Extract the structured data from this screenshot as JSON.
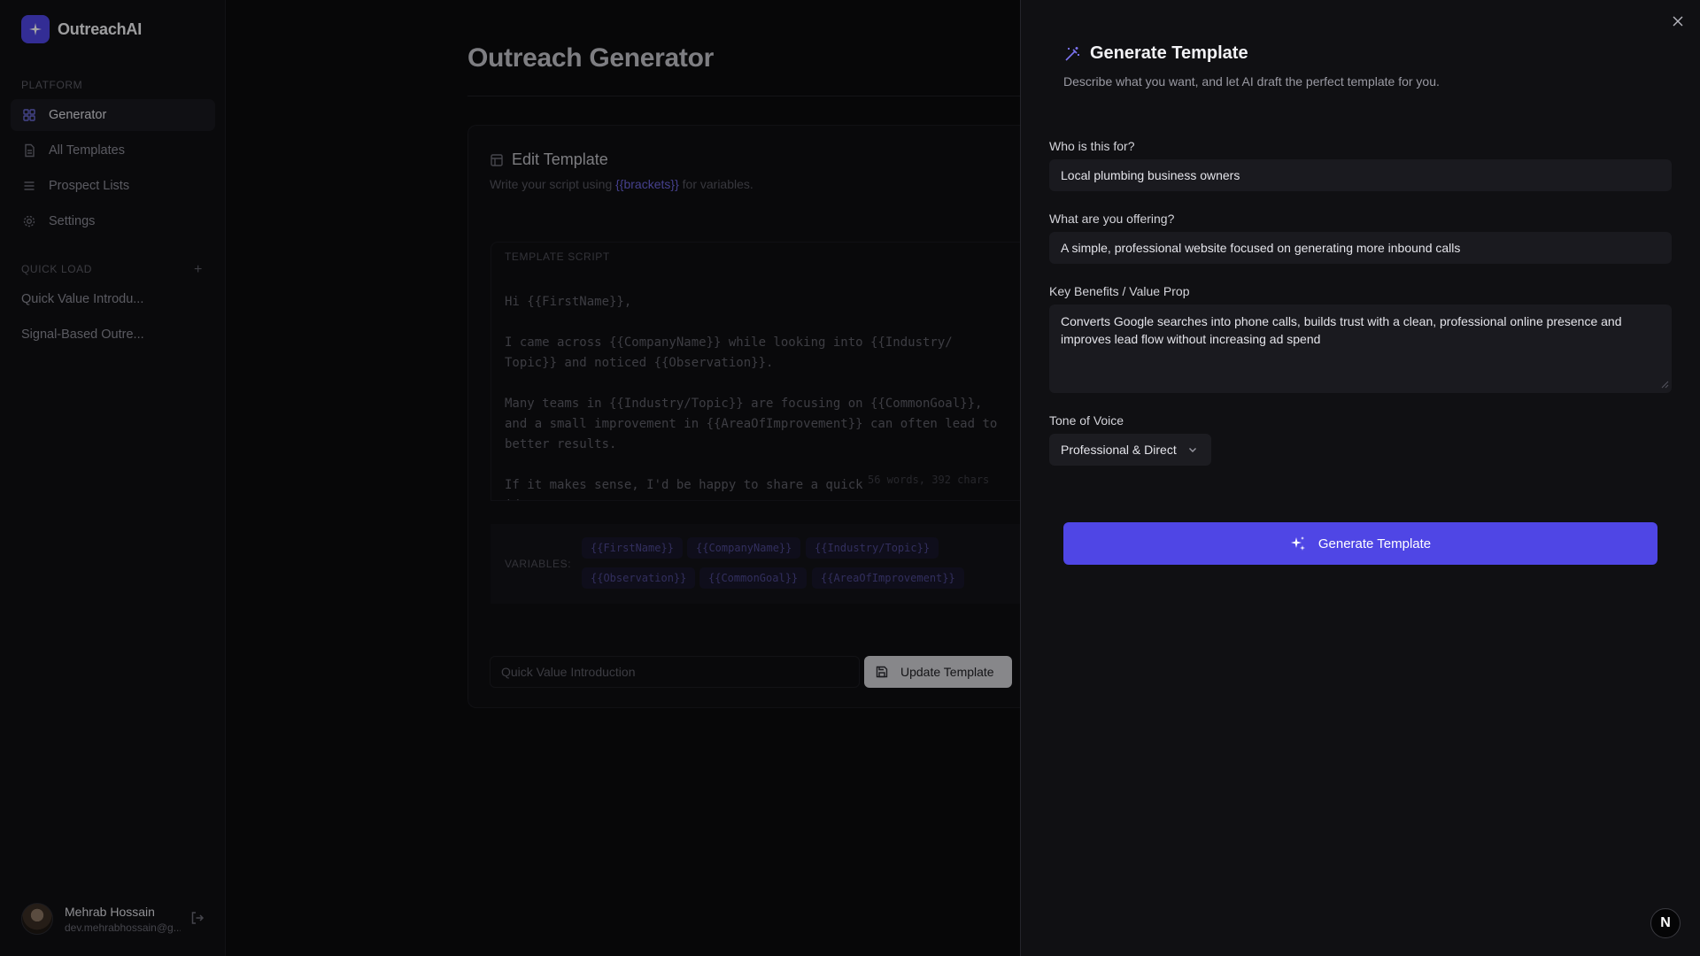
{
  "app": {
    "name": "OutreachAI"
  },
  "sidebar": {
    "platform_label": "PLATFORM",
    "items": [
      {
        "label": "Generator",
        "icon": "grid-icon",
        "active": true
      },
      {
        "label": "All Templates",
        "icon": "file-icon",
        "active": false
      },
      {
        "label": "Prospect Lists",
        "icon": "list-icon",
        "active": false
      },
      {
        "label": "Settings",
        "icon": "gear-icon",
        "active": false
      }
    ],
    "quick_load_label": "QUICK LOAD",
    "quick_load_items": [
      "Quick Value Introdu...",
      "Signal-Based Outre..."
    ],
    "user": {
      "name": "Mehrab Hossain",
      "email": "dev.mehrabhossain@g..."
    }
  },
  "main": {
    "title": "Outreach Generator",
    "editor": {
      "title": "Edit Template",
      "subtitle_prefix": "Write your script using",
      "subtitle_highlight": "{{brackets}}",
      "subtitle_suffix": "for variables.",
      "script_label": "TEMPLATE SCRIPT",
      "script_text": "Hi {{FirstName}},\n\nI came across {{CompanyName}} while looking into {{Industry/\nTopic}} and noticed {{Observation}}.\n\nMany teams in {{Industry/Topic}} are focusing on {{CommonGoal}},\nand a small improvement in {{AreaOfImprovement}} can often lead to\nbetter results.\n\nIf it makes sense, I'd be happy to share a quick\nidea or two.",
      "count": "56 words, 392 chars",
      "variables_label": "VARIABLES:",
      "variables": [
        "{{FirstName}}",
        "{{CompanyName}}",
        "{{Industry/Topic}}",
        "{{Observation}}",
        "{{CommonGoal}}",
        "{{AreaOfImprovement}}"
      ],
      "name_value": "Quick Value Introduction",
      "update_label": "Update Template"
    }
  },
  "drawer": {
    "title": "Generate Template",
    "subtitle": "Describe what you want, and let AI draft the perfect template for you.",
    "who_label": "Who is this for?",
    "who_value": "Local plumbing business owners",
    "offer_label": "What are you offering?",
    "offer_value": "A simple, professional website focused on generating more inbound calls",
    "benefits_label": "Key Benefits / Value Prop",
    "benefits_value": "Converts Google searches into phone calls, builds trust with a clean, professional online presence and improves lead flow without increasing ad spend",
    "tone_label": "Tone of Voice",
    "tone_value": "Professional & Direct",
    "generate_label": "Generate Template",
    "accent": "#4f46e5"
  },
  "badge": {
    "letter": "N"
  }
}
